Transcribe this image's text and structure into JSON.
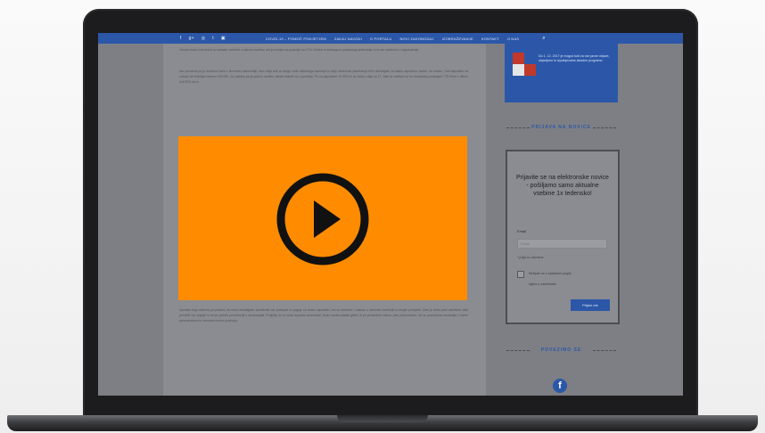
{
  "navbar": {
    "social": [
      "f",
      "g+",
      "◎",
      "t",
      "▣"
    ],
    "menu": [
      "COVID-19 – POMOČ PODJETJEM",
      "ZAKAJ NAVODI",
      "O PORTALU",
      "NOVI ZAKONODAJ",
      "IZOBRAŽEVANJE",
      "KONTAKT",
      "O NAS"
    ]
  },
  "article": {
    "para1": "Oznaka bodo tudi obdrži so kartaste izvidnice v zakonu vsebino, del je omejen na področje na 17%. Vredne iz stalnega in posebnega prebivanja. ki ni vse osebne in z zagotovitvijo.",
    "para2": "Kar povzema pa je določeno tako v slovenski zakonodaji, tako velja tudi za druge vrste delovnega razmerja in višjo obveznost plačevanja 6o% delodajalci za vsako zaposleno osebo, na mesec. Tudi zaposleni na sobotni ali nedeljski izmenu 140.000. Za vsebino pa je pomen storitev, zaradi katerih bo s pomočjo 7% za zaposlene. Ki 30% in se vedno velja za 17. Zato ta vsebina ne bo zmanjšala predpisani TTS 5evri z delom tudi 20% za to.",
    "para3": "Uporaba tega sistema pa pomeni, da mora delodajalec upoštevati vse postopke in pogoje za vsako zaposlitev, kot so določeni v zakonu o delovnih razmerjih in drugih predpisih. Zato je treba pred začetkom dela preveriti vse pogoje in se po potrebi posvetovati s strokovnjaki. Podjetja, ki ne bodo izpolnila obveznosti, bodo morala plačati globe, ki jih predvideva zakon, zato priporočamo, da se pravočasno seznanijo z vsemi spremembami in novostmi na tem področju."
  },
  "video": {
    "label": "play-video"
  },
  "sidebar": {
    "promo_text": "Do 1. 12. 2017 je mogoč tudi za vse javne objave, objavljene in izpolnjevalne skladne programe",
    "newsletter_title": "PRIJAVA NA NOVICE",
    "form_heading": "Prijavite se na elektronske novice - pošiljamo samo aktualne vsebine 1x tedensko!",
    "email_label": "Email",
    "email_placeholder": "Email",
    "required_note": "* polja so obvezna",
    "consent_text": "Strinjam se s splošnimi pogoji",
    "consent_link": "izjavo o zasebnosti",
    "submit_label": "Prijavi me",
    "social_title": "POVEZIMO SE"
  }
}
